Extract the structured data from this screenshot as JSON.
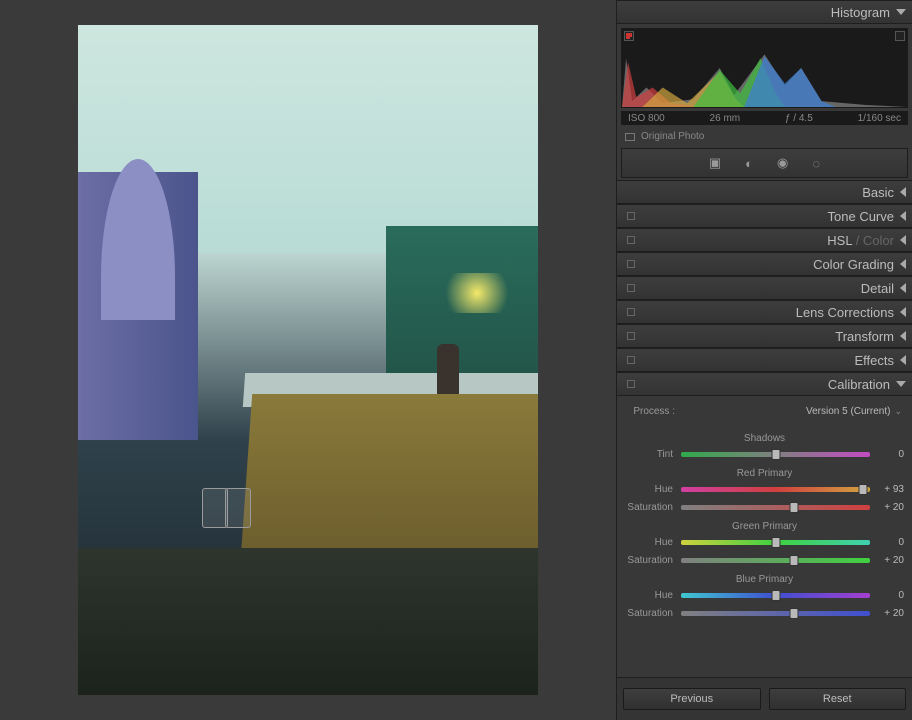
{
  "histogram": {
    "title": "Histogram",
    "iso": "ISO 800",
    "focal": "26 mm",
    "aperture": "ƒ / 4.5",
    "shutter": "1/160 sec",
    "original_label": "Original Photo"
  },
  "panels": {
    "basic": "Basic",
    "tone_curve": "Tone Curve",
    "hsl": "HSL",
    "hsl_sep": " / ",
    "hsl_color": "Color",
    "color_grading": "Color Grading",
    "detail": "Detail",
    "lens": "Lens Corrections",
    "transform": "Transform",
    "effects": "Effects",
    "calibration": "Calibration"
  },
  "calibration": {
    "process_label": "Process :",
    "process_value": "Version 5 (Current)",
    "shadows_title": "Shadows",
    "red_title": "Red Primary",
    "green_title": "Green Primary",
    "blue_title": "Blue Primary",
    "tint_label": "Tint",
    "hue_label": "Hue",
    "sat_label": "Saturation",
    "shadows": {
      "tint": 0
    },
    "red": {
      "hue": "+ 93",
      "sat": "+ 20"
    },
    "green": {
      "hue": 0,
      "sat": "+ 20"
    },
    "blue": {
      "hue": 0,
      "sat": "+ 20"
    }
  },
  "footer": {
    "previous": "Previous",
    "reset": "Reset"
  }
}
